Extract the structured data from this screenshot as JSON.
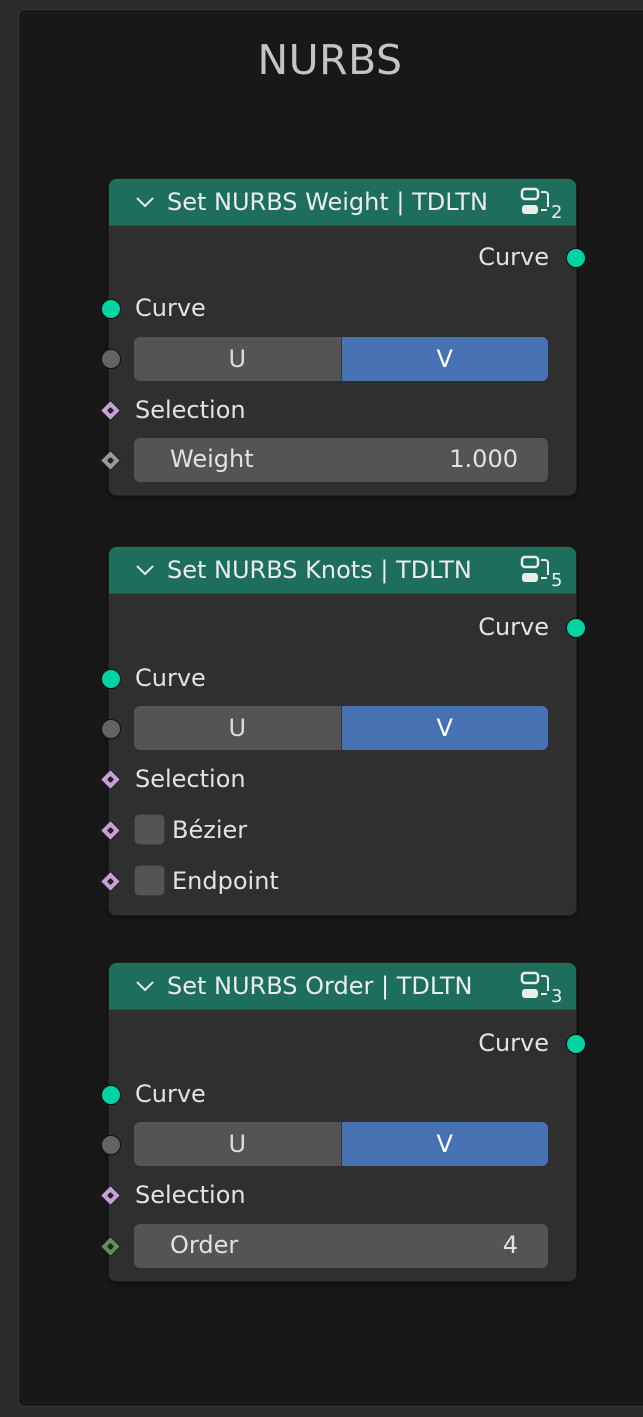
{
  "frame": {
    "title": "NURBS"
  },
  "colors": {
    "header": "#1d6e5c",
    "geometry_socket": "#00d4a3",
    "field_socket": "#c8a0d8",
    "int_socket": "#5f8f5f",
    "active_toggle": "#4672b4"
  },
  "nodes": [
    {
      "title": "Set NURBS Weight | TDLTN",
      "group_count": "2",
      "output": "Curve",
      "input_curve": "Curve",
      "toggle": {
        "u": "U",
        "v": "V",
        "active": "V"
      },
      "selection": "Selection",
      "weight": {
        "label": "Weight",
        "value": "1.000"
      }
    },
    {
      "title": "Set NURBS Knots | TDLTN",
      "group_count": "5",
      "output": "Curve",
      "input_curve": "Curve",
      "toggle": {
        "u": "U",
        "v": "V",
        "active": "V"
      },
      "selection": "Selection",
      "bezier": "Bézier",
      "endpoint": "Endpoint"
    },
    {
      "title": "Set NURBS Order | TDLTN",
      "group_count": "3",
      "output": "Curve",
      "input_curve": "Curve",
      "toggle": {
        "u": "U",
        "v": "V",
        "active": "V"
      },
      "selection": "Selection",
      "order": {
        "label": "Order",
        "value": "4"
      }
    }
  ]
}
